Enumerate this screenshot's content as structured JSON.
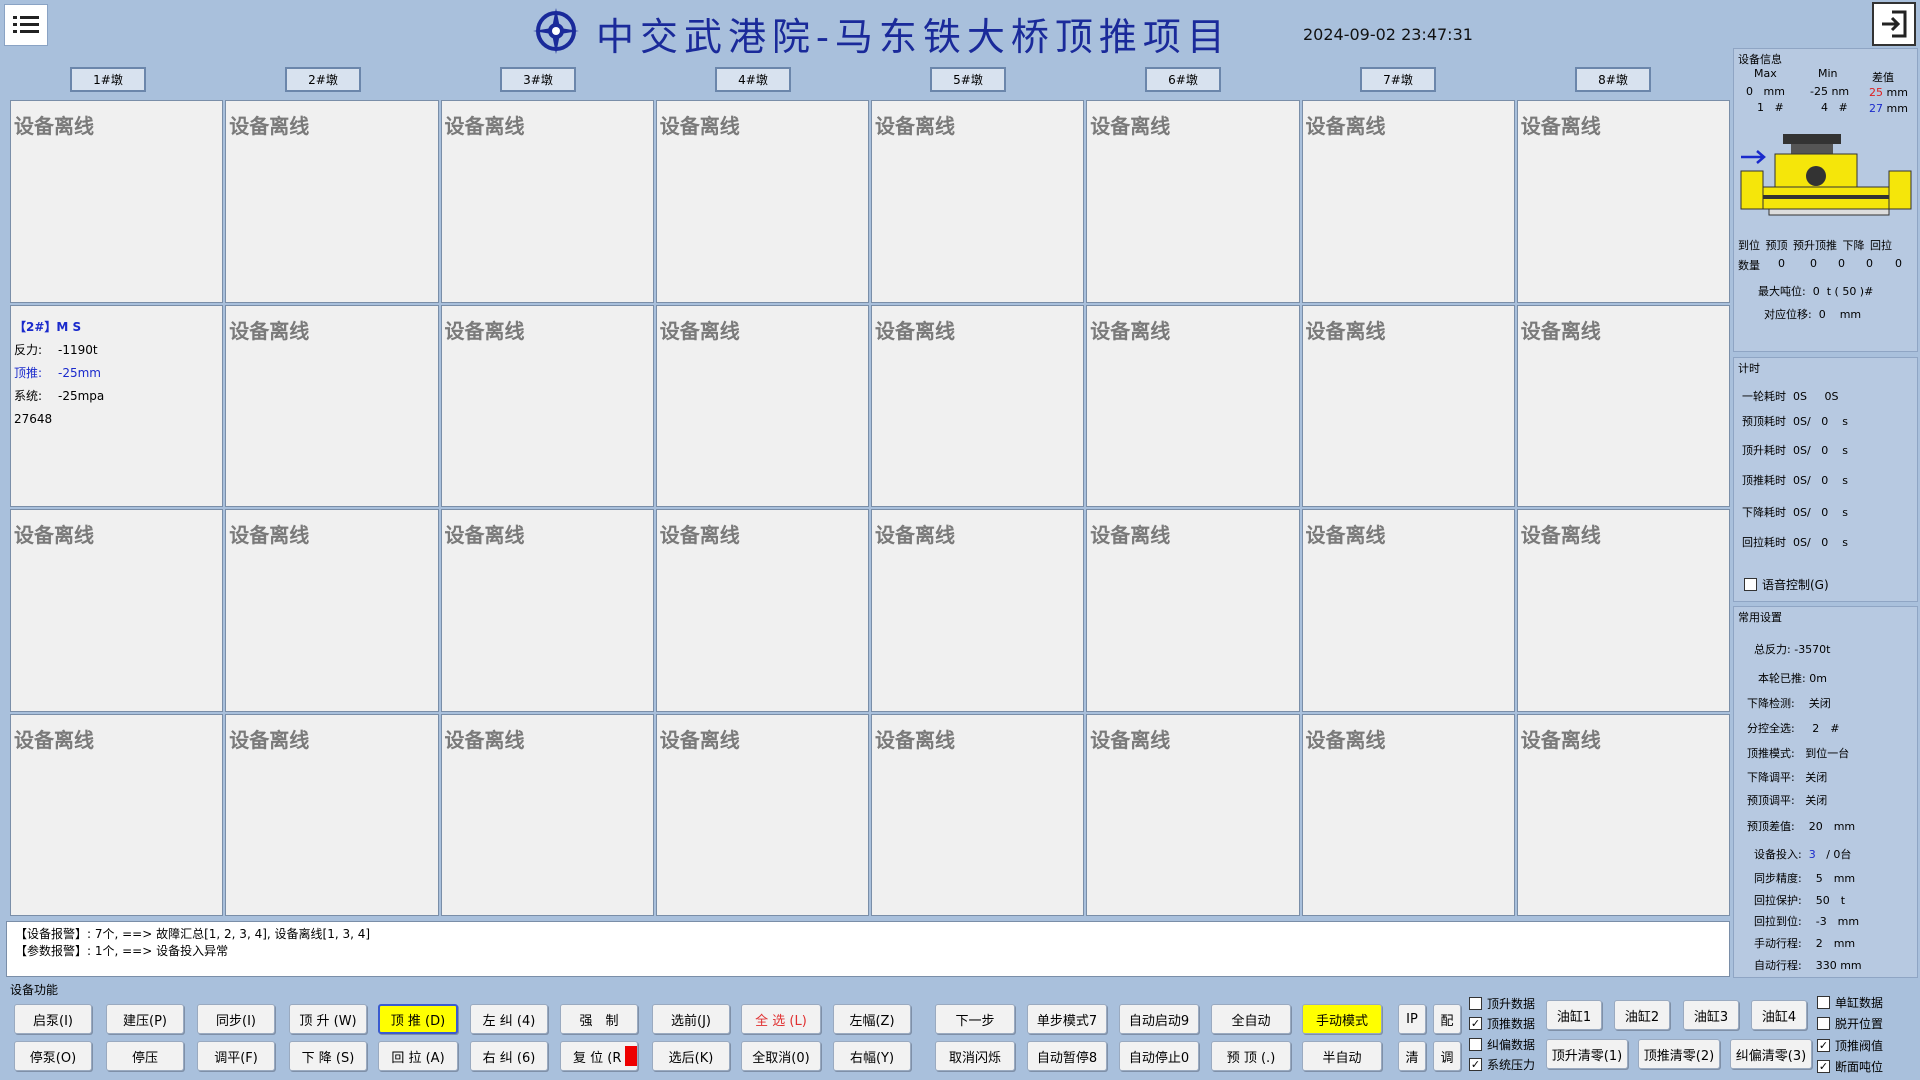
{
  "header": {
    "title": "中交武港院-马东铁大桥顶推项目",
    "datetime": "2024-09-02 23:47:31"
  },
  "piers": [
    "1#墩",
    "2#墩",
    "3#墩",
    "4#墩",
    "5#墩",
    "6#墩",
    "7#墩",
    "8#墩"
  ],
  "offline_text": "设备离线",
  "device_2": {
    "title": "【2#】M S",
    "force_label": "反力:",
    "force_value": "-1190t",
    "push_label": "顶推:",
    "push_value": "-25mm",
    "system_label": "系统:",
    "system_value": "-25mpa",
    "code": "27648"
  },
  "alarm": {
    "line1": "【设备报警】: 7个, ==> 故障汇总[1, 2, 3, 4], 设备离线[1, 3, 4]",
    "line2": "【参数报警】: 1个, ==> 设备投入异常"
  },
  "function_label": "设备功能",
  "buttons": {
    "start_pump": "启泵(I)",
    "stop_pump": "停泵(O)",
    "build_pressure": "建压(P)",
    "stop_pressure": "停压",
    "sync": "同步(I)",
    "level": "调平(F)",
    "lift": "顶 升 (W)",
    "lower": "下 降 (S)",
    "push": "顶 推 (D)",
    "pull_back": "回 拉 (A)",
    "left_correct": "左 纠 (4)",
    "right_correct": "右 纠 (6)",
    "force": "强　制",
    "reset": "复 位 (R",
    "select_front": "选前(J)",
    "select_back": "选后(K)",
    "select_all": "全 选 (L)",
    "deselect_all": "全取消(0)",
    "left_swing": "左幅(Z)",
    "right_swing": "右幅(Y)",
    "next_step": "下一步",
    "cancel_flash": "取消闪烁",
    "single_step": "单步模式7",
    "auto_pause": "自动暂停8",
    "auto_start": "自动启动9",
    "auto_stop": "自动停止0",
    "full_auto": "全自动",
    "pre_lift": "预 顶 (.)",
    "manual_mode": "手动模式",
    "semi_auto": "半自动",
    "ip": "IP",
    "config": "配",
    "clear": "清",
    "adjust": "调",
    "cyl1": "油缸1",
    "cyl2": "油缸2",
    "cyl3": "油缸3",
    "cyl4": "油缸4",
    "lift_zero": "顶升清零(1)",
    "push_zero": "顶推清零(2)",
    "correct_zero": "纠偏清零(3)"
  },
  "checkboxes": {
    "lift_data": {
      "label": "顶升数据",
      "checked": false
    },
    "push_data": {
      "label": "顶推数据",
      "checked": true
    },
    "correct_data": {
      "label": "纠偏数据",
      "checked": false
    },
    "system_pressure": {
      "label": "系统压力",
      "checked": true
    },
    "single_cyl": {
      "label": "单缸数据",
      "checked": false
    },
    "detach_pos": {
      "label": "脱开位置",
      "checked": false
    },
    "push_threshold": {
      "label": "顶推阀值",
      "checked": true
    },
    "cutoff_tonnage": {
      "label": "断面吨位",
      "checked": true
    }
  },
  "device_info": {
    "title": "设备信息",
    "max_label": "Max",
    "min_label": "Min",
    "diff_label": "差值",
    "max_val": "0",
    "max_unit": "mm",
    "max_idx": "1",
    "max_idx_unit": "#",
    "min_val": "-25 nm",
    "min_idx": "4",
    "min_idx_unit": "#",
    "diff_val1": "25",
    "diff_unit1": "mm",
    "diff_val2": "27",
    "diff_unit2": "mm",
    "status_headers": [
      "到位",
      "预顶",
      "预升",
      "顶推",
      "下降",
      "回拉"
    ],
    "count_label": "数量",
    "counts": [
      "0",
      "0",
      "0",
      "0",
      "0"
    ],
    "max_tonnage_label": "最大吨位:",
    "max_tonnage_val": "0",
    "max_tonnage_unit": "t ( 50 )#",
    "disp_label": "对应位移:",
    "disp_val": "0",
    "disp_unit": "mm"
  },
  "timing": {
    "title": "计时",
    "rows": [
      {
        "label": "一轮耗时",
        "a": "0S",
        "b": "0S",
        "c": ""
      },
      {
        "label": "预顶耗时",
        "a": "0S/",
        "b": "0",
        "c": "s"
      },
      {
        "label": "顶升耗时",
        "a": "0S/",
        "b": "0",
        "c": "s"
      },
      {
        "label": "顶推耗时",
        "a": "0S/",
        "b": "0",
        "c": "s"
      },
      {
        "label": "下降耗时",
        "a": "0S/",
        "b": "0",
        "c": "s"
      },
      {
        "label": "回拉耗时",
        "a": "0S/",
        "b": "0",
        "c": "s"
      }
    ],
    "voice_label": "语音控制(G)"
  },
  "settings": {
    "title": "常用设置",
    "rows": [
      {
        "label": "总反力:",
        "value": "-3570t"
      },
      {
        "label": "本轮已推:",
        "value": "0m"
      },
      {
        "label": "下降检测:",
        "value": "关闭"
      },
      {
        "label": "分控全选:",
        "value": "2　#"
      },
      {
        "label": "顶推模式:",
        "value": "到位一台"
      },
      {
        "label": "下降调平:",
        "value": "关闭"
      },
      {
        "label": "预顶调平:",
        "value": "关闭"
      },
      {
        "label": "预顶差值:",
        "value": "20　mm"
      },
      {
        "label": "设备投入:",
        "value": "3",
        "value2": "/ 0台"
      },
      {
        "label": "同步精度:",
        "value": "5　mm"
      },
      {
        "label": "回拉保护:",
        "value": "50　t"
      },
      {
        "label": "回拉到位:",
        "value": "-3　mm"
      },
      {
        "label": "手动行程:",
        "value": "2　mm"
      },
      {
        "label": "自动行程:",
        "value": "330 mm"
      }
    ]
  }
}
